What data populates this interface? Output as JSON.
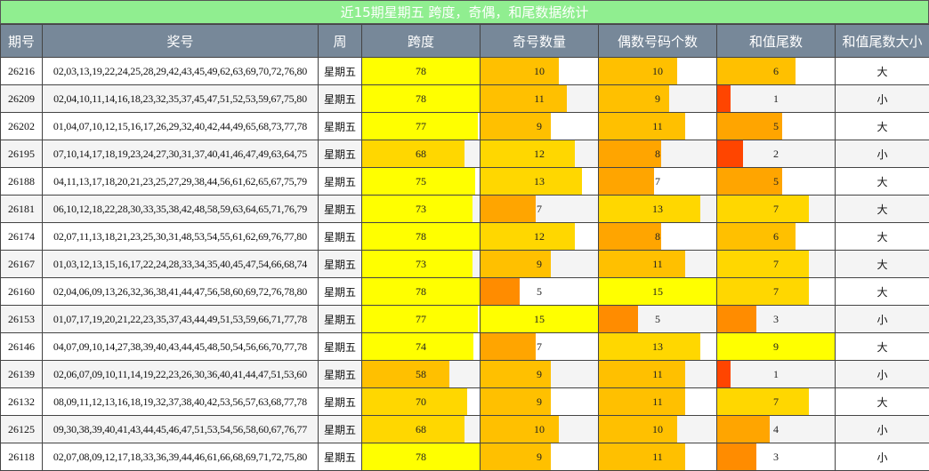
{
  "title": "近15期星期五 跨度，奇偶，和尾数据统计",
  "headers": [
    "期号",
    "奖号",
    "周",
    "跨度",
    "奇号数量",
    "偶数号码个数",
    "和值尾数",
    "和值尾数大小"
  ],
  "colors": {
    "header_bg": "#778899",
    "title_bg": "#90ee90",
    "bar_scale": [
      "#ff2200",
      "#ff4500",
      "#ff8c00",
      "#ffa500",
      "#ffc000",
      "#ffd700",
      "#ffff00"
    ]
  },
  "chart_data": {
    "type": "table",
    "title": "近15期星期五 跨度，奇偶，和尾数据统计",
    "columns": [
      "期号",
      "奖号",
      "周",
      "跨度",
      "奇号数量",
      "偶数号码个数",
      "和值尾数",
      "和值尾数大小"
    ],
    "scales": {
      "span_max": 78,
      "odd_max": 15,
      "even_max": 15,
      "tail_max": 9
    },
    "rows": [
      {
        "issue": "26216",
        "numbers": "02,03,13,19,22,24,25,28,29,42,43,45,49,62,63,69,70,72,76,80",
        "week": "星期五",
        "span": 78,
        "odd": 10,
        "even": 10,
        "tail": 6,
        "size": "大"
      },
      {
        "issue": "26209",
        "numbers": "02,04,10,11,14,16,18,23,32,35,37,45,47,51,52,53,59,67,75,80",
        "week": "星期五",
        "span": 78,
        "odd": 11,
        "even": 9,
        "tail": 1,
        "size": "小"
      },
      {
        "issue": "26202",
        "numbers": "01,04,07,10,12,15,16,17,26,29,32,40,42,44,49,65,68,73,77,78",
        "week": "星期五",
        "span": 77,
        "odd": 9,
        "even": 11,
        "tail": 5,
        "size": "大"
      },
      {
        "issue": "26195",
        "numbers": "07,10,14,17,18,19,23,24,27,30,31,37,40,41,46,47,49,63,64,75",
        "week": "星期五",
        "span": 68,
        "odd": 12,
        "even": 8,
        "tail": 2,
        "size": "小"
      },
      {
        "issue": "26188",
        "numbers": "04,11,13,17,18,20,21,23,25,27,29,38,44,56,61,62,65,67,75,79",
        "week": "星期五",
        "span": 75,
        "odd": 13,
        "even": 7,
        "tail": 5,
        "size": "大"
      },
      {
        "issue": "26181",
        "numbers": "06,10,12,18,22,28,30,33,35,38,42,48,58,59,63,64,65,71,76,79",
        "week": "星期五",
        "span": 73,
        "odd": 7,
        "even": 13,
        "tail": 7,
        "size": "大"
      },
      {
        "issue": "26174",
        "numbers": "02,07,11,13,18,21,23,25,30,31,48,53,54,55,61,62,69,76,77,80",
        "week": "星期五",
        "span": 78,
        "odd": 12,
        "even": 8,
        "tail": 6,
        "size": "大"
      },
      {
        "issue": "26167",
        "numbers": "01,03,12,13,15,16,17,22,24,28,33,34,35,40,45,47,54,66,68,74",
        "week": "星期五",
        "span": 73,
        "odd": 9,
        "even": 11,
        "tail": 7,
        "size": "大"
      },
      {
        "issue": "26160",
        "numbers": "02,04,06,09,13,26,32,36,38,41,44,47,56,58,60,69,72,76,78,80",
        "week": "星期五",
        "span": 78,
        "odd": 5,
        "even": 15,
        "tail": 7,
        "size": "大"
      },
      {
        "issue": "26153",
        "numbers": "01,07,17,19,20,21,22,23,35,37,43,44,49,51,53,59,66,71,77,78",
        "week": "星期五",
        "span": 77,
        "odd": 15,
        "even": 5,
        "tail": 3,
        "size": "小"
      },
      {
        "issue": "26146",
        "numbers": "04,07,09,10,14,27,38,39,40,43,44,45,48,50,54,56,66,70,77,78",
        "week": "星期五",
        "span": 74,
        "odd": 7,
        "even": 13,
        "tail": 9,
        "size": "大"
      },
      {
        "issue": "26139",
        "numbers": "02,06,07,09,10,11,14,19,22,23,26,30,36,40,41,44,47,51,53,60",
        "week": "星期五",
        "span": 58,
        "odd": 9,
        "even": 11,
        "tail": 1,
        "size": "小"
      },
      {
        "issue": "26132",
        "numbers": "08,09,11,12,13,16,18,19,32,37,38,40,42,53,56,57,63,68,77,78",
        "week": "星期五",
        "span": 70,
        "odd": 9,
        "even": 11,
        "tail": 7,
        "size": "大"
      },
      {
        "issue": "26125",
        "numbers": "09,30,38,39,40,41,43,44,45,46,47,51,53,54,56,58,60,67,76,77",
        "week": "星期五",
        "span": 68,
        "odd": 10,
        "even": 10,
        "tail": 4,
        "size": "小"
      },
      {
        "issue": "26118",
        "numbers": "02,07,08,09,12,17,18,33,36,39,44,46,61,66,68,69,71,72,75,80",
        "week": "星期五",
        "span": 78,
        "odd": 9,
        "even": 11,
        "tail": 3,
        "size": "小"
      }
    ]
  }
}
